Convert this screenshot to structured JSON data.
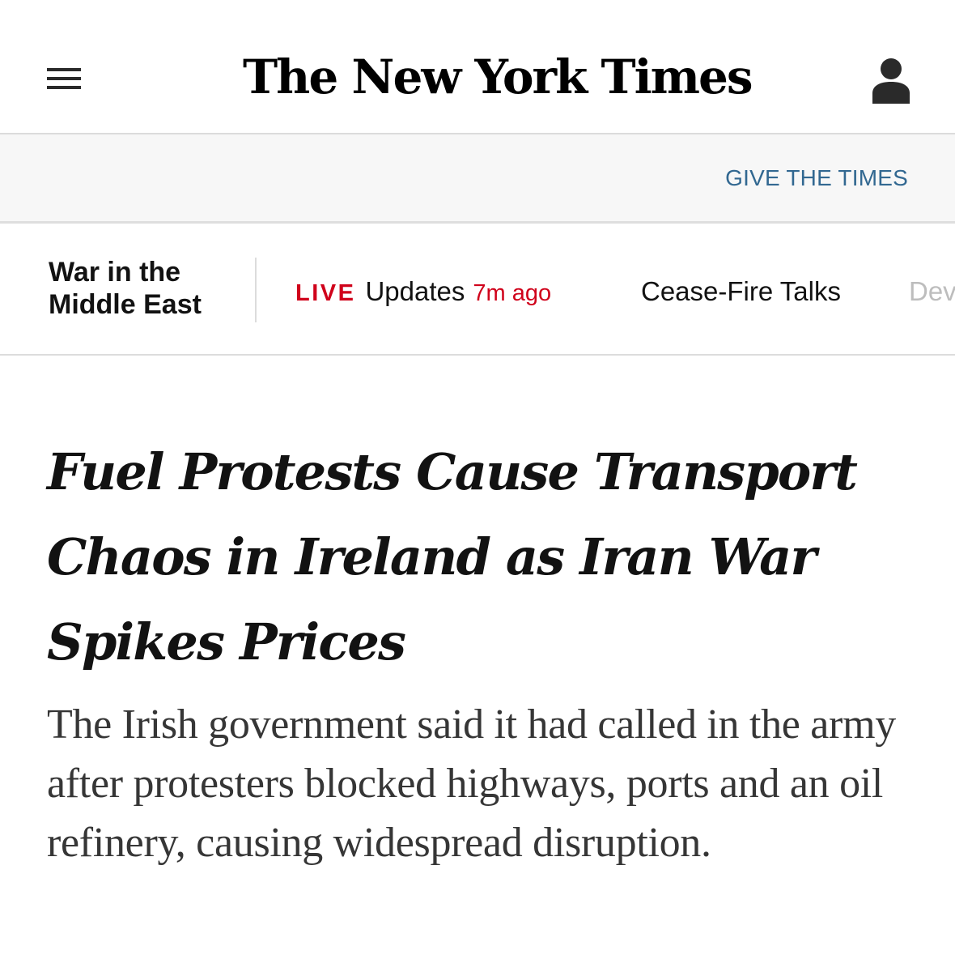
{
  "header": {
    "menu_icon": "hamburger-menu-icon",
    "logo_text": "The New York Times",
    "account_icon": "user-account-icon"
  },
  "gift_bar": {
    "link_label": "GIVE THE TIMES"
  },
  "story_nav": {
    "section_label": "War in the Middle East",
    "live": {
      "tag": "LIVE",
      "label": "Updates",
      "time": "7m ago"
    },
    "links": [
      {
        "label": "Cease-Fire Talks"
      },
      {
        "label": "Dev"
      }
    ]
  },
  "article": {
    "headline": "Fuel Protests Cause Transport Chaos in Ireland as Iran War Spikes Prices",
    "summary": "The Irish government said it had called in the army after protesters blocked highways, ports and an oil refinery, causing widespread disruption."
  },
  "colors": {
    "link_blue": "#326891",
    "live_red": "#d0021b",
    "text_dark": "#121212",
    "summary_gray": "#363636",
    "bar_bg": "#f7f7f7"
  }
}
